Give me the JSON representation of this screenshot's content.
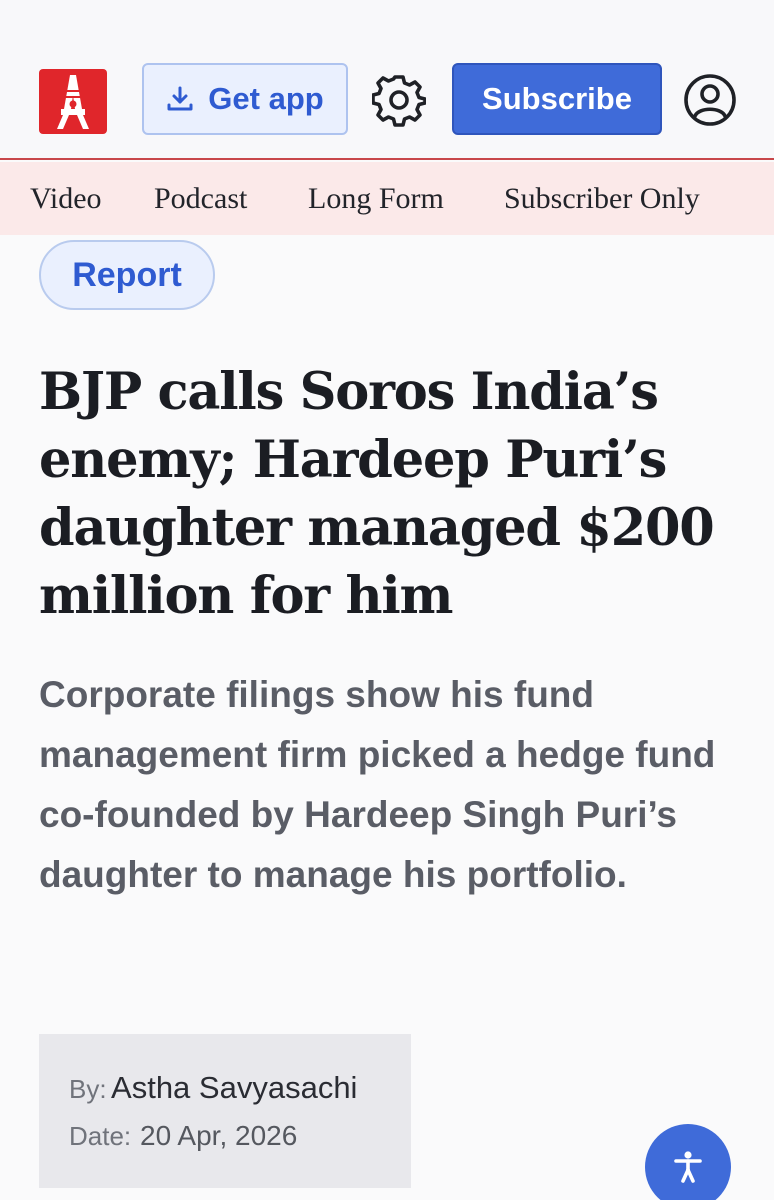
{
  "header": {
    "logo_icon": "clothespin-logo-icon",
    "get_app_label": "Get app",
    "download_icon": "download-icon",
    "settings_icon": "gear-icon",
    "subscribe_label": "Subscribe",
    "account_icon": "user-circle-icon",
    "colors": {
      "brand": "#e0262b",
      "accent": "#3f6bd9",
      "nav_bg": "#fbe9e9"
    }
  },
  "nav": {
    "items": [
      {
        "label": "Video"
      },
      {
        "label": "Podcast"
      },
      {
        "label": "Long Form"
      },
      {
        "label": "Subscriber Only"
      }
    ]
  },
  "article": {
    "tag": "Report",
    "headline": "BJP calls Soros India’s enemy; Hardeep Puri’s daughter managed $200 million for him",
    "dek": "Corporate filings show his fund management firm picked a hedge fund co-founded by Hardeep Singh Puri’s daughter to manage his portfolio.",
    "byline": {
      "by_label": "By:",
      "author": "Astha Savyasachi",
      "date_label": "Date:",
      "date": "20 Apr, 2026"
    }
  },
  "accessibility_button": {
    "icon": "accessibility-icon"
  }
}
